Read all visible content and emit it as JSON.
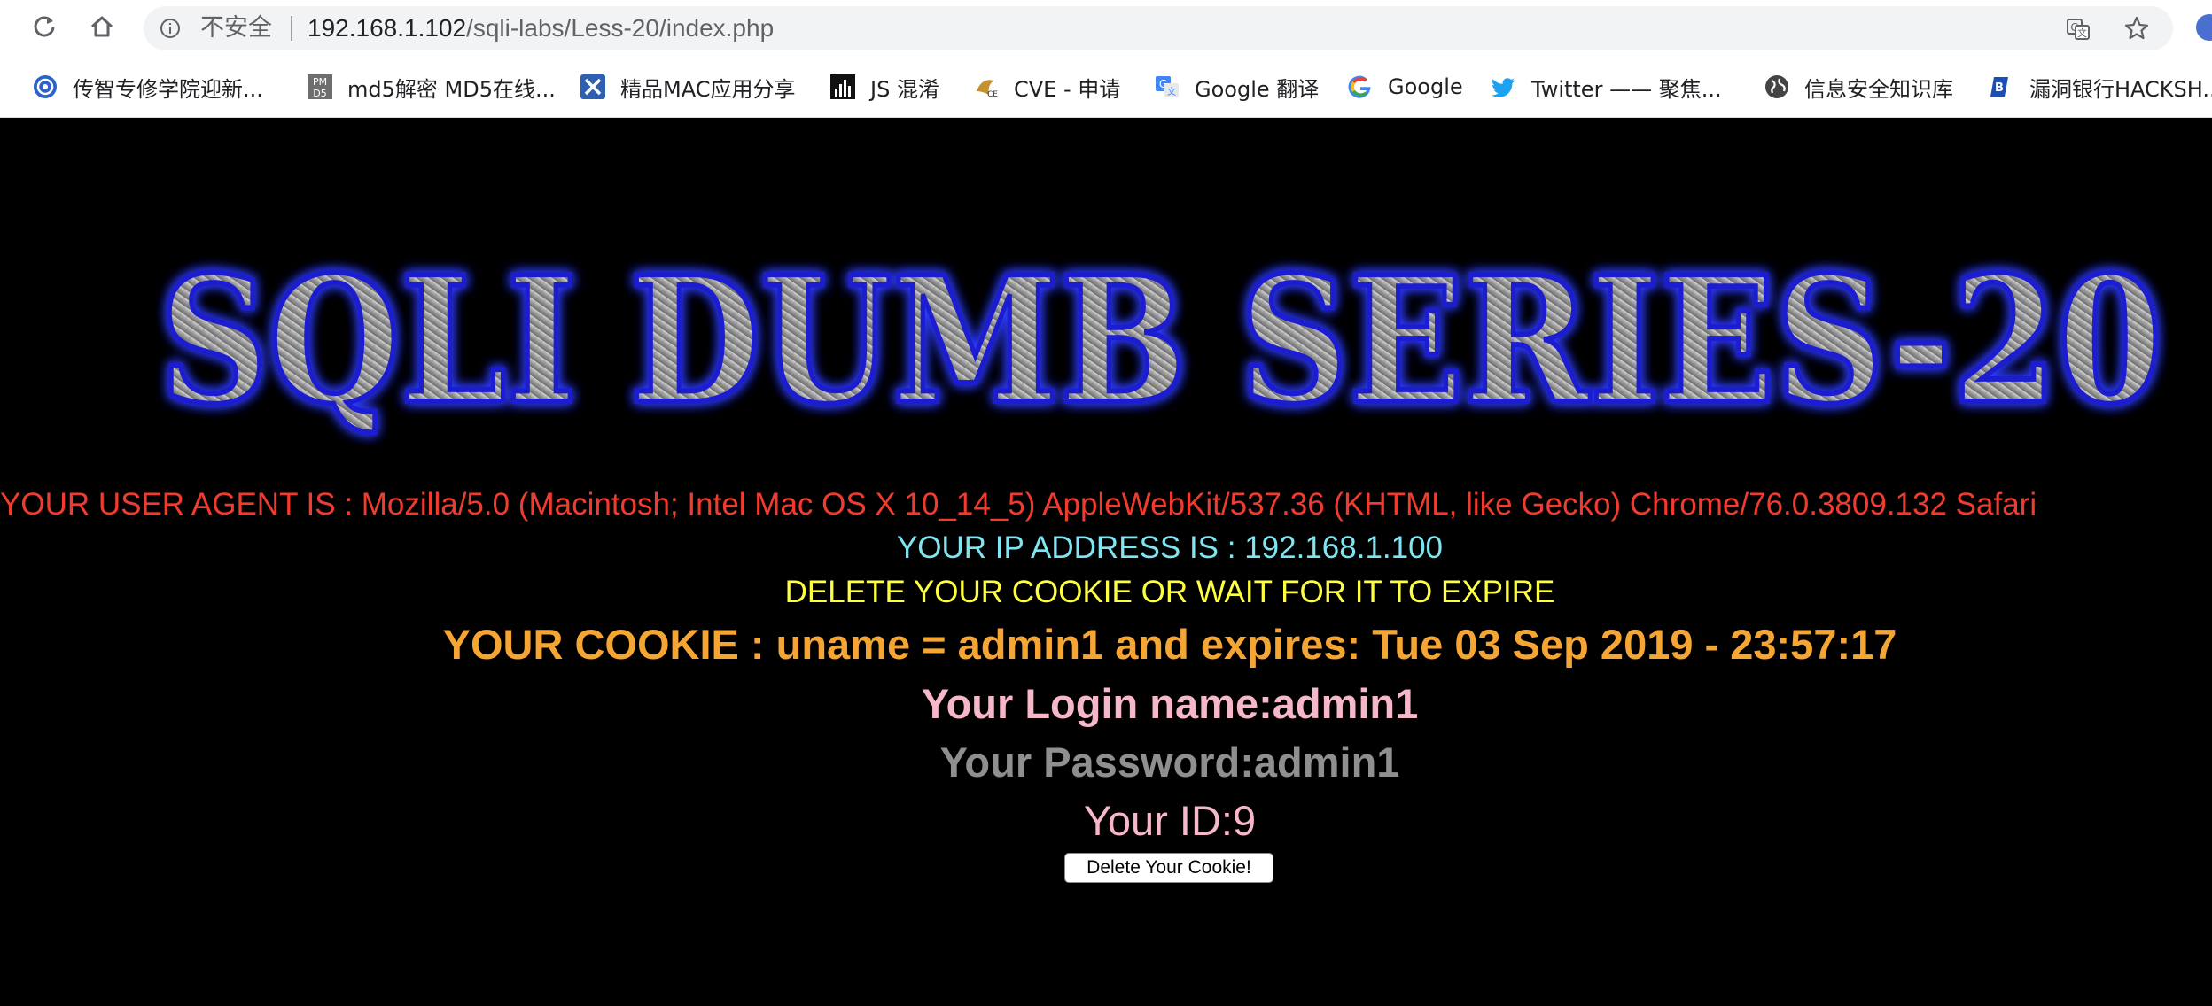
{
  "browser": {
    "security_label": "不安全",
    "url_host": "192.168.1.102",
    "url_path": "/sqli-labs/Less-20/index.php",
    "bookmarks": [
      {
        "label": "传智专修学院迎新...",
        "icon": "campus-icon"
      },
      {
        "label": "md5解密 MD5在线...",
        "icon": "pmd5-icon"
      },
      {
        "label": "精品MAC应用分享",
        "icon": "mac-app-icon"
      },
      {
        "label": "JS 混淆",
        "icon": "js-chart-icon"
      },
      {
        "label": "CVE - 申请",
        "icon": "cve-icon"
      },
      {
        "label": "Google 翻译",
        "icon": "google-translate-icon"
      },
      {
        "label": "Google",
        "icon": "google-icon"
      },
      {
        "label": "Twitter —— 聚焦...",
        "icon": "twitter-icon"
      },
      {
        "label": "信息安全知识库",
        "icon": "globe-icon"
      },
      {
        "label": "漏洞银行HACKSH...",
        "icon": "bugbank-icon"
      }
    ]
  },
  "page": {
    "banner_text": "SQLI DUMB SERIES-20",
    "user_agent": "YOUR USER AGENT IS : Mozilla/5.0 (Macintosh; Intel Mac OS X 10_14_5) AppleWebKit/537.36 (KHTML, like Gecko) Chrome/76.0.3809.132 Safari",
    "ip": "YOUR IP ADDRESS IS : 192.168.1.100",
    "delete_msg": "DELETE YOUR COOKIE OR WAIT FOR IT TO EXPIRE",
    "cookie": "YOUR COOKIE : uname = admin1 and expires: Tue 03 Sep 2019 - 23:57:17",
    "login_name": "Your Login name:admin1",
    "password": "Your Password:admin1",
    "id": "Your ID:9",
    "delete_button": "Delete Your Cookie!"
  },
  "colors": {
    "user_agent": "#f23b2f",
    "ip": "#7fe5f0",
    "delete_msg": "#ffff42",
    "cookie": "#f4a534",
    "login": "#f6b8c8",
    "password": "#8f8f8f"
  }
}
